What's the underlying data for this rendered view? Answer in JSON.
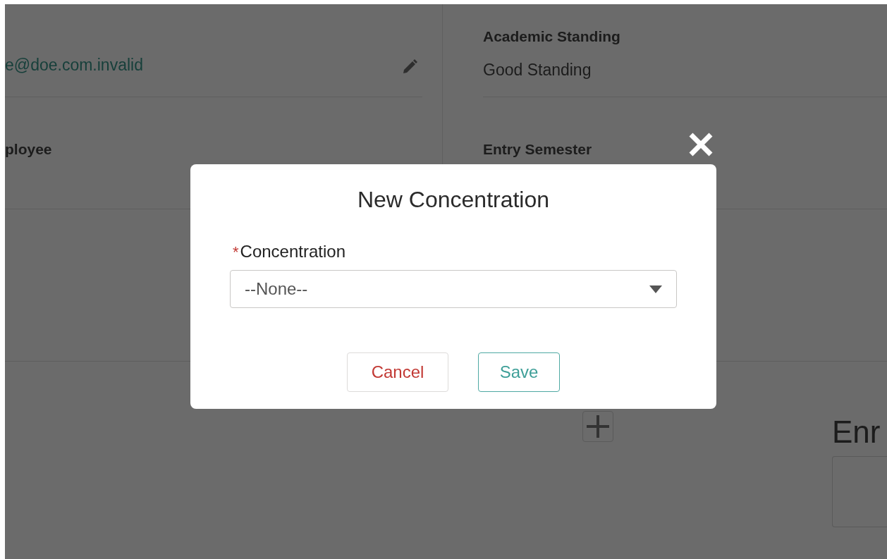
{
  "background": {
    "left_column": {
      "email": "e@doe.com.invalid",
      "field_label": "ployee"
    },
    "right_column": {
      "fields": [
        {
          "label": "Academic Standing",
          "value": "Good Standing"
        },
        {
          "label": "Entry Semester"
        }
      ]
    },
    "section_heading": "Enr"
  },
  "modal": {
    "title": "New Concentration",
    "field": {
      "label": "Concentration",
      "required": true,
      "required_mark": "*",
      "value": "--None--"
    },
    "buttons": [
      {
        "label": "Cancel",
        "kind": "cancel"
      },
      {
        "label": "Save",
        "kind": "save"
      }
    ]
  }
}
